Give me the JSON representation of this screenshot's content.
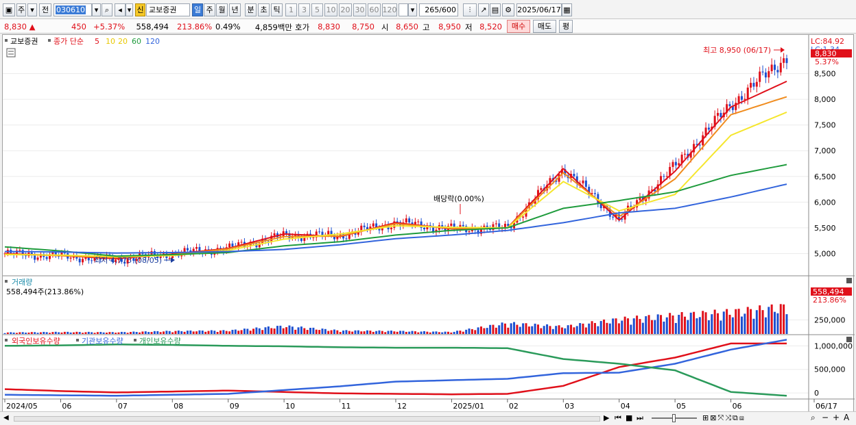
{
  "toolbar": {
    "market": "주",
    "prev": "전",
    "code": "030610",
    "credit_badge": "신",
    "stock_name": "교보증권",
    "periods": [
      "일",
      "주",
      "월",
      "년",
      "분",
      "초",
      "틱"
    ],
    "active_period": "일",
    "intervals": [
      "1",
      "3",
      "5",
      "10",
      "20",
      "30",
      "60",
      "120"
    ],
    "count": "265",
    "count_max": "/600",
    "date": "2025/06/17"
  },
  "infobar": {
    "price": "8,830",
    "change": "450",
    "change_pct": "+5.37%",
    "volume": "558,494",
    "volume_ratio": "213.86%",
    "turnover": "0.49%",
    "amount": "4,859백만",
    "ask_label": "호가",
    "ask1": "8,830",
    "ask2": "8,750",
    "open_label": "시",
    "open": "8,650",
    "high_label": "고",
    "high": "8,950",
    "low_label": "저",
    "low": "8,520",
    "buy_btn": "매수",
    "sell_btn": "매도",
    "eval_btn": "평"
  },
  "panels": {
    "price_title": "교보증권",
    "ma_title": "종가 단순",
    "ma_periods": [
      "5",
      "10",
      "20",
      "60",
      "120"
    ],
    "lc_label": "LC:84.92",
    "lc2_label": "LC:1.34",
    "price_tag": "8,830",
    "price_pct_tag": "5.37%",
    "high_annotation": "최고 8,950 (06/17)",
    "low_annotation": "최저 4,775 (08/05)",
    "dividend_annotation": "배당락(0.00%)",
    "volume_title": "거래량",
    "volume_value": "558,494주(213.86%)",
    "volume_tag": "558,494",
    "volume_pct_tag": "213.86%",
    "holdings_titles": [
      "외국인보유수량",
      "기관보유수량",
      "개인보유수량"
    ]
  },
  "colors": {
    "up": "#e0101a",
    "down": "#1c4fd0",
    "ma5": "#e0101a",
    "ma10": "#f08c1e",
    "ma20": "#f5e62d",
    "ma60": "#1e9b3c",
    "ma120": "#3264dc",
    "foreign": "#e0101a",
    "institution": "#3264dc",
    "individual": "#2a9a5a"
  },
  "chart_data": [
    {
      "type": "candlestick",
      "title": "교보증권",
      "ylim": [
        4700,
        8960
      ],
      "y_ticks": [
        5000,
        5500,
        6000,
        6500,
        7000,
        7500,
        8000,
        8500
      ],
      "x_labels": [
        "2024/05",
        "06",
        "07",
        "08",
        "09",
        "10",
        "11",
        "12",
        "2025/01",
        "02",
        "03",
        "04",
        "05",
        "06",
        "06/17"
      ],
      "series": [
        {
          "name": "종가",
          "x": [
            "2024/05",
            "06",
            "07",
            "08",
            "09",
            "10",
            "11",
            "12",
            "2025/01",
            "02",
            "03",
            "04",
            "05",
            "06",
            "06/17"
          ],
          "values": [
            5000,
            4950,
            4880,
            5000,
            5100,
            5350,
            5350,
            5600,
            5480,
            5500,
            6650,
            5650,
            6700,
            7900,
            8830
          ]
        },
        {
          "name": "5",
          "x": [
            "2024/05",
            "06",
            "07",
            "08",
            "09",
            "10",
            "11",
            "12",
            "2025/01",
            "02",
            "03",
            "04",
            "05",
            "06",
            "06/17"
          ],
          "values": [
            5000,
            4960,
            4900,
            4990,
            5100,
            5380,
            5330,
            5600,
            5480,
            5500,
            6650,
            5650,
            6600,
            7850,
            8350
          ]
        },
        {
          "name": "10",
          "x": [
            "2024/05",
            "06",
            "07",
            "08",
            "09",
            "10",
            "11",
            "12",
            "2025/01",
            "02",
            "03",
            "04",
            "05",
            "06",
            "06/17"
          ],
          "values": [
            4990,
            4960,
            4920,
            4980,
            5090,
            5330,
            5340,
            5580,
            5490,
            5500,
            6570,
            5720,
            6450,
            7700,
            8050
          ]
        },
        {
          "name": "20",
          "x": [
            "2024/05",
            "06",
            "07",
            "08",
            "09",
            "10",
            "11",
            "12",
            "2025/01",
            "02",
            "03",
            "04",
            "05",
            "06",
            "06/17"
          ],
          "values": [
            4980,
            4970,
            4940,
            4960,
            5060,
            5280,
            5380,
            5540,
            5510,
            5500,
            6400,
            5830,
            6150,
            7300,
            7750
          ]
        },
        {
          "name": "60",
          "x": [
            "2024/05",
            "06",
            "07",
            "08",
            "09",
            "10",
            "11",
            "12",
            "2025/01",
            "02",
            "03",
            "04",
            "05",
            "06",
            "06/17"
          ],
          "values": [
            5130,
            5050,
            4950,
            4980,
            5020,
            5150,
            5230,
            5360,
            5450,
            5500,
            5880,
            6030,
            6200,
            6520,
            6730
          ]
        },
        {
          "name": "120",
          "x": [
            "2024/05",
            "06",
            "07",
            "08",
            "09",
            "10",
            "11",
            "12",
            "2025/01",
            "02",
            "03",
            "04",
            "05",
            "06",
            "06/17"
          ],
          "values": [
            5040,
            5030,
            5010,
            5020,
            5040,
            5080,
            5170,
            5290,
            5360,
            5450,
            5600,
            5790,
            5880,
            6100,
            6350
          ]
        }
      ],
      "annotations": [
        {
          "text": "최고 8,950 (06/17)",
          "x": "06/17",
          "y": 8950
        },
        {
          "text": "최저 4,775 (08/05)",
          "x": "08/05",
          "y": 4775
        },
        {
          "text": "배당락(0.00%)",
          "x": "12",
          "y": 5750
        }
      ]
    },
    {
      "type": "bar",
      "title": "거래량",
      "ylim": [
        0,
        980000
      ],
      "y_ticks": [
        250000
      ],
      "x": [
        "2024/05",
        "06",
        "07",
        "08",
        "09",
        "10",
        "11",
        "12",
        "2025/01",
        "02",
        "03",
        "04",
        "05",
        "06",
        "06/17"
      ],
      "values": [
        30000,
        40000,
        35000,
        60000,
        70000,
        160000,
        70000,
        60000,
        40000,
        220000,
        150000,
        300000,
        380000,
        450000,
        558494
      ]
    },
    {
      "type": "line",
      "title": "외국인보유수량 / 기관보유수량 / 개인보유수량",
      "ylim": [
        -100000,
        1150000
      ],
      "y_ticks": [
        0,
        500000,
        1000000
      ],
      "x": [
        "2024/05",
        "06",
        "07",
        "08",
        "09",
        "10",
        "11",
        "12",
        "2025/01",
        "02",
        "03",
        "04",
        "05",
        "06",
        "06/17"
      ],
      "series": [
        {
          "name": "외국인보유수량",
          "values": [
            80000,
            40000,
            10000,
            30000,
            50000,
            20000,
            -10000,
            -20000,
            -30000,
            -20000,
            150000,
            550000,
            750000,
            1050000,
            1050000
          ]
        },
        {
          "name": "기관보유수량",
          "values": [
            -40000,
            -50000,
            -60000,
            -40000,
            -20000,
            60000,
            140000,
            240000,
            270000,
            300000,
            420000,
            430000,
            620000,
            920000,
            1130000
          ]
        },
        {
          "name": "개인보유수량",
          "values": [
            1000000,
            1010000,
            1030000,
            1020000,
            1000000,
            990000,
            970000,
            960000,
            960000,
            950000,
            720000,
            620000,
            480000,
            20000,
            -60000
          ]
        }
      ]
    }
  ]
}
